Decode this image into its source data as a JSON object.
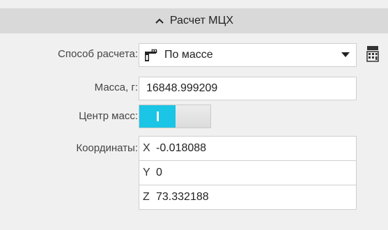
{
  "header": {
    "title": "Расчет МЦХ",
    "icon": "chevron-up-icon"
  },
  "method": {
    "label": "Способ расчета:",
    "value": "По массе",
    "icon": "mass-method-icon",
    "dropdown_icon": "caret-down-icon",
    "action_icon": "calculator-icon"
  },
  "mass": {
    "label": "Масса, г:",
    "value": "16848.999209"
  },
  "center_of_mass": {
    "label": "Центр масс:",
    "state": "on"
  },
  "coordinates": {
    "label": "Координаты:",
    "rows": [
      {
        "axis": "X",
        "value": "-0.018088"
      },
      {
        "axis": "Y",
        "value": "0"
      },
      {
        "axis": "Z",
        "value": "73.332188"
      }
    ]
  },
  "colors": {
    "toggle_on": "#1ac5e5",
    "header_bg": "#d9d9d9",
    "panel_bg": "#f0f0f0"
  }
}
